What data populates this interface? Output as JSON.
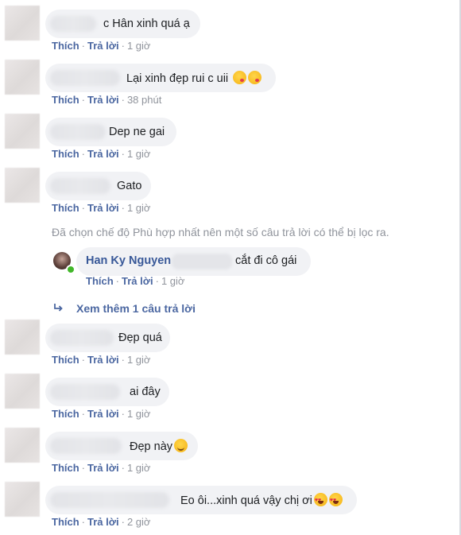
{
  "comments": [
    {
      "text": "c Hân xinh quá ạ",
      "emojis": [],
      "time": "1 giờ"
    },
    {
      "text": "Lại xinh đẹp rui c uii",
      "emojis": [
        "kiss-emoji",
        "kiss-emoji"
      ],
      "time": "38 phút"
    },
    {
      "text": "Dep ne gai",
      "emojis": [],
      "time": "1 giờ"
    },
    {
      "text": "Gato",
      "emojis": [],
      "time": "1 giờ"
    },
    {
      "text": "Đẹp quá",
      "emojis": [],
      "time": "1 giờ"
    },
    {
      "text": "ai đây",
      "emojis": [],
      "time": "1 giờ"
    },
    {
      "text": "Đẹp này",
      "emojis": [
        "smile-emoji"
      ],
      "time": "1 giờ"
    },
    {
      "text": "Eo ôi...xinh quá vậy chị ơi",
      "emojis": [
        "heart-eyes-emoji",
        "heart-eyes-emoji"
      ],
      "time": "2 giờ"
    }
  ],
  "actions": {
    "like": "Thích",
    "reply": "Trả lời",
    "separator": "·"
  },
  "notice": "Đã chọn chế độ Phù hợp nhất nên một số câu trả lời có thể bị lọc ra.",
  "reply": {
    "author": "Han Ky Nguyen",
    "text": "cắt đi cô gái",
    "time": "1 giờ"
  },
  "more_replies": {
    "icon": "reply-arrow-icon",
    "label": "Xem thêm 1 câu trả lời"
  }
}
